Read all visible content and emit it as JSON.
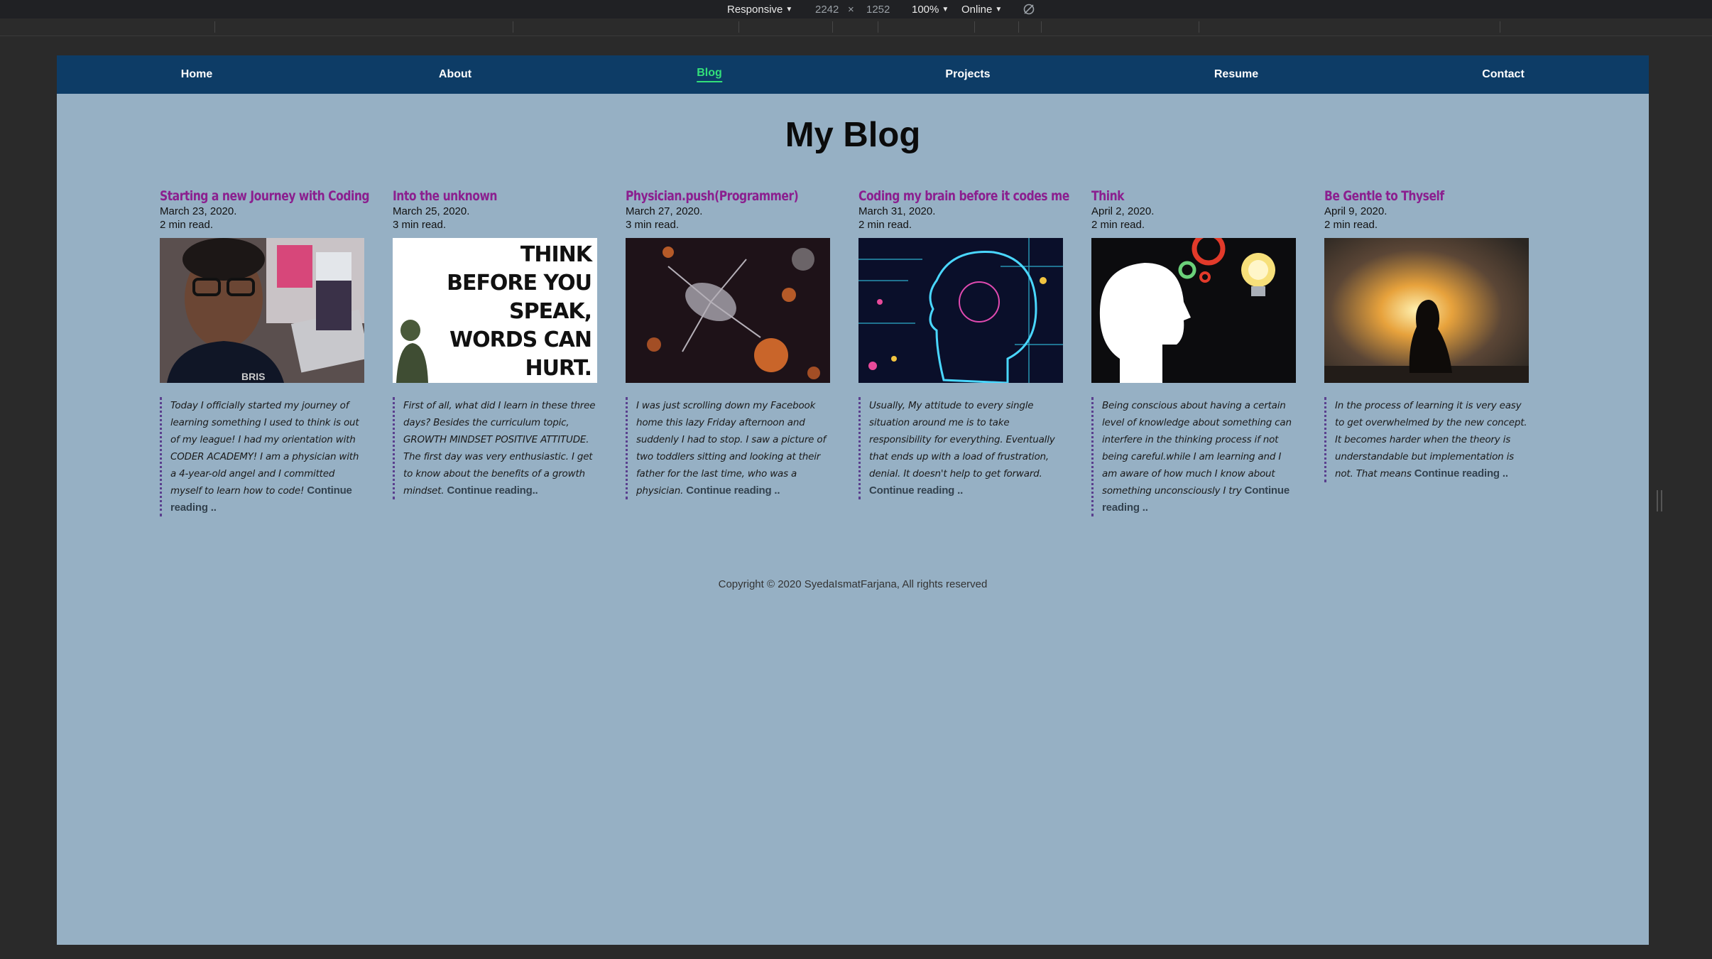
{
  "devtools": {
    "device": "Responsive",
    "width": "2242",
    "times": "×",
    "height": "1252",
    "zoom": "100%",
    "network": "Online"
  },
  "nav": {
    "items": [
      {
        "label": "Home"
      },
      {
        "label": "About"
      },
      {
        "label": "Blog"
      },
      {
        "label": "Projects"
      },
      {
        "label": "Resume"
      },
      {
        "label": "Contact"
      }
    ]
  },
  "heading": "My Blog",
  "posts": [
    {
      "title": "Starting a new Journey with Coding",
      "date": "March 23, 2020.",
      "read": "2 min read.",
      "excerpt": "Today I officially started my journey of learning something I used to think is out of my league! I had my orientation with CODER ACADEMY! I am a physician with a 4-year-old angel and I committed myself to learn how to code!",
      "more": "Continue reading .."
    },
    {
      "title": "Into the unknown",
      "date": "March 25, 2020.",
      "read": "3 min read.",
      "excerpt": "First of all, what did I learn in these three days? Besides the curriculum topic, GROWTH MINDSET POSITIVE ATTITUDE. The first day was very enthusiastic. I get to know about the benefits of a growth mindset.",
      "more": "Continue reading.."
    },
    {
      "title": "Physician.push(Programmer)",
      "date": "March 27, 2020.",
      "read": "3 min read.",
      "excerpt": "I was just scrolling down my Facebook home this lazy Friday afternoon and suddenly I had to stop. I saw a picture of two toddlers sitting and looking at their father for the last time, who was a physician.",
      "more": "Continue reading .."
    },
    {
      "title": "Coding my brain before it codes me",
      "date": "March 31, 2020.",
      "read": "2 min read.",
      "excerpt": "Usually, My attitude to every single situation around me is to take responsibility for everything. Eventually that ends up with a load of frustration, denial. It doesn't help to get forward.",
      "more": "Continue reading .."
    },
    {
      "title": "Think",
      "date": "April 2, 2020.",
      "read": "2 min read.",
      "excerpt": "Being conscious about having a certain level of knowledge about something can interfere in the thinking process if not being careful.while I am learning and I am aware of how much I know about something unconsciously I try",
      "more": "Continue reading .."
    },
    {
      "title": "Be Gentle to Thyself",
      "date": "April 9, 2020.",
      "read": "2 min read.",
      "excerpt": "In the process of learning it is very easy to get overwhelmed by the new concept. It becomes harder when the theory is understandable but implementation is not. That means",
      "more": "Continue reading .."
    }
  ],
  "thumb2": {
    "lines": [
      "THINK",
      "BEFORE YOU",
      "SPEAK,",
      "WORDS CAN",
      "HURT."
    ]
  },
  "footer": "Copyright © 2020 SyedaIsmatFarjana, All rights reserved"
}
